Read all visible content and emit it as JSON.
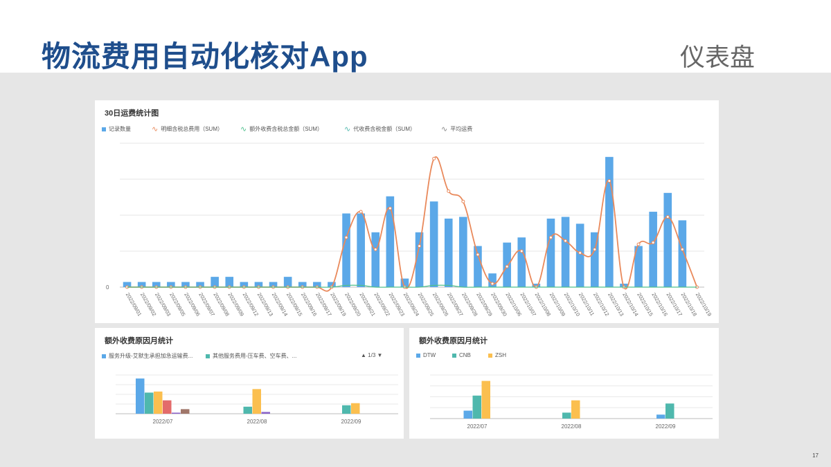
{
  "header": {
    "title": "物流费用自动化核对App",
    "subtitle": "仪表盘"
  },
  "page_number": "17",
  "colors": {
    "blue": "#5ba8e8",
    "orange": "#e9895b",
    "green": "#4fc08d",
    "teal": "#4fb8ad",
    "gray": "#888888",
    "yellow": "#fbbf4f",
    "red": "#e36b6b",
    "purple": "#8a63c9",
    "brown": "#a0776a"
  },
  "chart_data": [
    {
      "type": "bar",
      "title": "30日运费统计图",
      "legend": [
        {
          "name": "记录数量",
          "icon": "square",
          "color": "#5ba8e8"
        },
        {
          "name": "明细含税总费用（SUM）",
          "icon": "wave",
          "color": "#e9895b"
        },
        {
          "name": "额外收费含税总金额（SUM）",
          "icon": "wave",
          "color": "#4fc08d"
        },
        {
          "name": "代收费含税金额（SUM）",
          "icon": "wave",
          "color": "#4fb8ad"
        },
        {
          "name": "平均运费",
          "icon": "wave",
          "color": "#888888"
        }
      ],
      "zero_label": "0",
      "categories": [
        "2022/09/01",
        "2022/09/02",
        "2022/09/03",
        "2022/09/05",
        "2022/09/06",
        "2022/09/07",
        "2022/09/08",
        "2022/09/09",
        "2022/09/12",
        "2022/09/13",
        "2022/09/14",
        "2022/09/15",
        "2022/09/16",
        "2022/09/17",
        "2022/09/19",
        "2022/09/20",
        "2022/09/21",
        "2022/09/22",
        "2022/09/23",
        "2022/09/24",
        "2022/09/25",
        "2022/09/26",
        "2022/09/27",
        "2022/09/28",
        "2022/09/29",
        "2022/09/30",
        "2022/10/06",
        "2022/10/07",
        "2022/10/08",
        "2022/10/09",
        "2022/10/10",
        "2022/10/11",
        "2022/10/12",
        "2022/10/13",
        "2022/10/14",
        "2022/10/15",
        "2022/10/16",
        "2022/10/17",
        "2022/10/18",
        "2022/10/19"
      ],
      "series": [
        {
          "name": "记录数量",
          "type": "bar",
          "color": "#5ba8e8",
          "values": [
            1.5,
            1.5,
            1.5,
            1.5,
            1.5,
            1.5,
            3,
            3,
            1.5,
            1.5,
            1.5,
            3,
            1.5,
            1.5,
            1.5,
            21.5,
            21.5,
            16,
            26.5,
            2.5,
            16,
            25,
            20,
            20.5,
            12,
            4,
            13,
            14.5,
            1,
            20,
            20.5,
            18.5,
            16,
            38,
            1,
            12,
            22,
            27.5,
            19.5,
            0
          ]
        },
        {
          "name": "明细含税总费用（SUM）",
          "type": "line",
          "color": "#e9895b",
          "values": [
            0,
            0,
            0,
            0,
            0,
            0,
            0,
            0,
            0,
            0,
            0,
            0,
            0,
            0,
            0,
            14.5,
            22,
            11,
            23,
            0,
            12,
            37.5,
            28,
            25,
            9.5,
            1,
            6,
            10.5,
            0,
            14.5,
            13.5,
            10,
            11,
            31,
            0,
            12.5,
            13,
            20.5,
            11,
            0
          ]
        },
        {
          "name": "额外收费含税总金额（SUM）",
          "type": "line",
          "color": "#4fc08d",
          "values": [
            0,
            0,
            0,
            0,
            0,
            0,
            0,
            0,
            0,
            0,
            0,
            0,
            0,
            0,
            0,
            0.5,
            0.5,
            0,
            0,
            0,
            0,
            0.5,
            0.5,
            0,
            0,
            0,
            0,
            0,
            0,
            0,
            0,
            0,
            0,
            0,
            0,
            0,
            0,
            0,
            0,
            0
          ]
        }
      ],
      "y_range": [
        0,
        42
      ],
      "grid": true
    },
    {
      "type": "bar",
      "title": "额外收费原因月统计",
      "legend": [
        {
          "name": "服务升级-艾默生承担加急运输费...",
          "color": "#5ba8e8"
        },
        {
          "name": "其他服务费用-压车费、空车费、...",
          "color": "#4fb8ad"
        }
      ],
      "pager": "▲ 1/3 ▼",
      "categories": [
        "2022/07",
        "2022/08",
        "2022/09"
      ],
      "series": [
        {
          "name": "服务升级-艾默生承担加急运输费...",
          "color": "#5ba8e8",
          "values": [
            10,
            0,
            0
          ]
        },
        {
          "name": "其他服务费用-压车费、空车费、...",
          "color": "#4fb8ad",
          "values": [
            6,
            2,
            2.4
          ]
        },
        {
          "color": "#fbbf4f",
          "values": [
            6.3,
            7,
            3
          ]
        },
        {
          "color": "#e36b6b",
          "values": [
            3.8,
            0,
            0
          ]
        },
        {
          "color": "#8a63c9",
          "values": [
            0.3,
            0.5,
            0
          ]
        },
        {
          "color": "#a0776a",
          "values": [
            1.3,
            0,
            0
          ]
        }
      ],
      "y_range": [
        0,
        11
      ]
    },
    {
      "type": "bar",
      "title": "额外收费原因月统计",
      "legend": [
        {
          "name": "DTW",
          "color": "#5ba8e8"
        },
        {
          "name": "CNB",
          "color": "#4fb8ad"
        },
        {
          "name": "ZSH",
          "color": "#fbbf4f"
        }
      ],
      "categories": [
        "2022/07",
        "2022/08",
        "2022/09"
      ],
      "series": [
        {
          "name": "DTW",
          "color": "#5ba8e8",
          "values": [
            2,
            0,
            1
          ]
        },
        {
          "name": "CNB",
          "color": "#4fb8ad",
          "values": [
            5.8,
            1.5,
            3.8
          ]
        },
        {
          "name": "ZSH",
          "color": "#fbbf4f",
          "values": [
            9.5,
            4.6,
            0
          ]
        }
      ],
      "y_range": [
        0,
        11
      ]
    }
  ]
}
